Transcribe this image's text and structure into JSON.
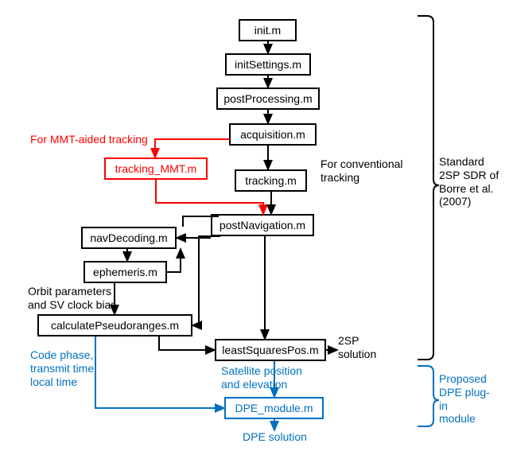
{
  "nodes": {
    "init": "init.m",
    "initSettings": "initSettings.m",
    "postProcessing": "postProcessing.m",
    "acquisition": "acquisition.m",
    "trackingMMT": "tracking_MMT.m",
    "tracking": "tracking.m",
    "postNavigation": "postNavigation.m",
    "navDecoding": "navDecoding.m",
    "ephemeris": "ephemeris.m",
    "calcPseudo": "calculatePseudoranges.m",
    "leastSquares": "leastSquaresPos.m",
    "dpeModule": "DPE_module.m"
  },
  "labels": {
    "mmtAided": "For MMT-aided tracking",
    "conventional": "For conventional\ntracking",
    "orbit": "Orbit parameters\nand SV clock bias",
    "codePhase": "Code phase,\ntransmit time,\nlocal time",
    "satPos": "Satellite position\nand elevation",
    "twoSP": "2SP\nsolution",
    "dpeSol": "DPE solution",
    "rightTop": "Standard\n2SP SDR of\nBorre et al.\n(2007)",
    "rightBot": "Proposed\nDPE plug-\nin\nmodule"
  }
}
